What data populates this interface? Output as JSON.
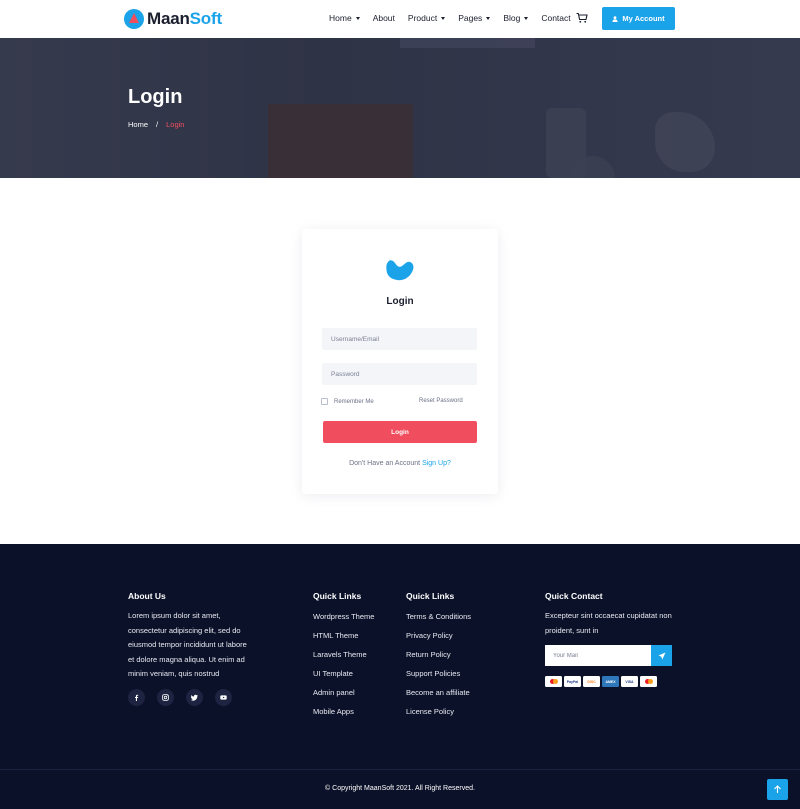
{
  "header": {
    "logo": {
      "part1": "Maan",
      "part2": "Soft"
    },
    "nav": [
      {
        "label": "Home",
        "has_dropdown": true
      },
      {
        "label": "About",
        "has_dropdown": false
      },
      {
        "label": "Product",
        "has_dropdown": true
      },
      {
        "label": "Pages",
        "has_dropdown": true
      },
      {
        "label": "Blog",
        "has_dropdown": true
      },
      {
        "label": "Contact",
        "has_dropdown": false
      }
    ],
    "cart_icon": "cart-icon",
    "account_button": "My Account"
  },
  "banner": {
    "title": "Login",
    "breadcrumb": {
      "home": "Home",
      "separator": "/",
      "current": "Login"
    }
  },
  "login_card": {
    "title": "Login",
    "username_placeholder": "Username/Email",
    "password_placeholder": "Password",
    "remember_label": "Remember Me",
    "reset_label": "Reset Password",
    "submit_label": "Login",
    "signup_prompt": "Don't Have an Account",
    "signup_link": "Sign Up",
    "signup_suffix": "?"
  },
  "footer": {
    "about": {
      "heading": "About Us",
      "text": "Lorem ipsum dolor sit amet, consectetur adipiscing elit, sed do eiusmod tempor incididunt ut labore et dolore magna aliqua. Ut enim ad minim veniam, quis nostrud"
    },
    "social": [
      "facebook-icon",
      "instagram-icon",
      "twitter-icon",
      "youtube-icon"
    ],
    "quick_links_1": {
      "heading": "Quick Links",
      "links": [
        "Wordpress Theme",
        "HTML Theme",
        "Laravels Theme",
        "UI Template",
        "Admin panel",
        "Mobile Apps"
      ]
    },
    "quick_links_2": {
      "heading": "Quick Links",
      "links": [
        "Terms & Conditions",
        "Privacy Policy",
        "Return Policy",
        "Support Policies",
        "Become an affiliate",
        "License Policy"
      ]
    },
    "contact": {
      "heading": "Quick Contact",
      "text": "Excepteur sint occaecat cupidatat non proident, sunt in",
      "mail_placeholder": "Your Mail",
      "payments": [
        "mastercard",
        "paypal",
        "discover",
        "american-express",
        "VISA",
        "mastercard"
      ]
    },
    "copyright": "© Copyright MaanSoft 2021. All Right Reserved."
  },
  "colors": {
    "accent": "#1aa3e8",
    "primary_red": "#f04e5e",
    "footer_bg": "#0b1128",
    "banner_bg": "#2f3346"
  }
}
